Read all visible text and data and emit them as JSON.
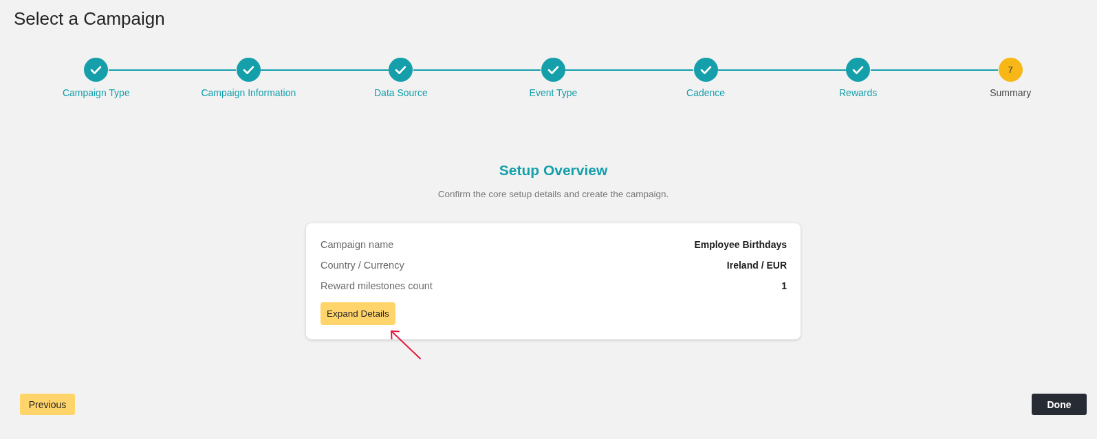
{
  "page": {
    "title": "Select a Campaign"
  },
  "steps": [
    {
      "label": "Campaign Type",
      "completed": true,
      "selected": false
    },
    {
      "label": "Campaign Information",
      "completed": true,
      "selected": false
    },
    {
      "label": "Data Source",
      "completed": true,
      "selected": false
    },
    {
      "label": "Event Type",
      "completed": true,
      "selected": false
    },
    {
      "label": "Cadence",
      "completed": true,
      "selected": false
    },
    {
      "label": "Rewards",
      "completed": true,
      "selected": false
    },
    {
      "label": "Summary",
      "number": "7",
      "completed": false,
      "selected": true
    }
  ],
  "overview": {
    "title": "Setup Overview",
    "subtitle": "Confirm the core setup details and create the campaign.",
    "rows": [
      {
        "label": "Campaign name",
        "value": "Employee Birthdays"
      },
      {
        "label": "Country / Currency",
        "value": "Ireland / EUR"
      },
      {
        "label": "Reward milestones count",
        "value": "1"
      }
    ],
    "expand_button": "Expand Details"
  },
  "footer": {
    "previous_button": "Previous",
    "done_button": "Done"
  }
}
